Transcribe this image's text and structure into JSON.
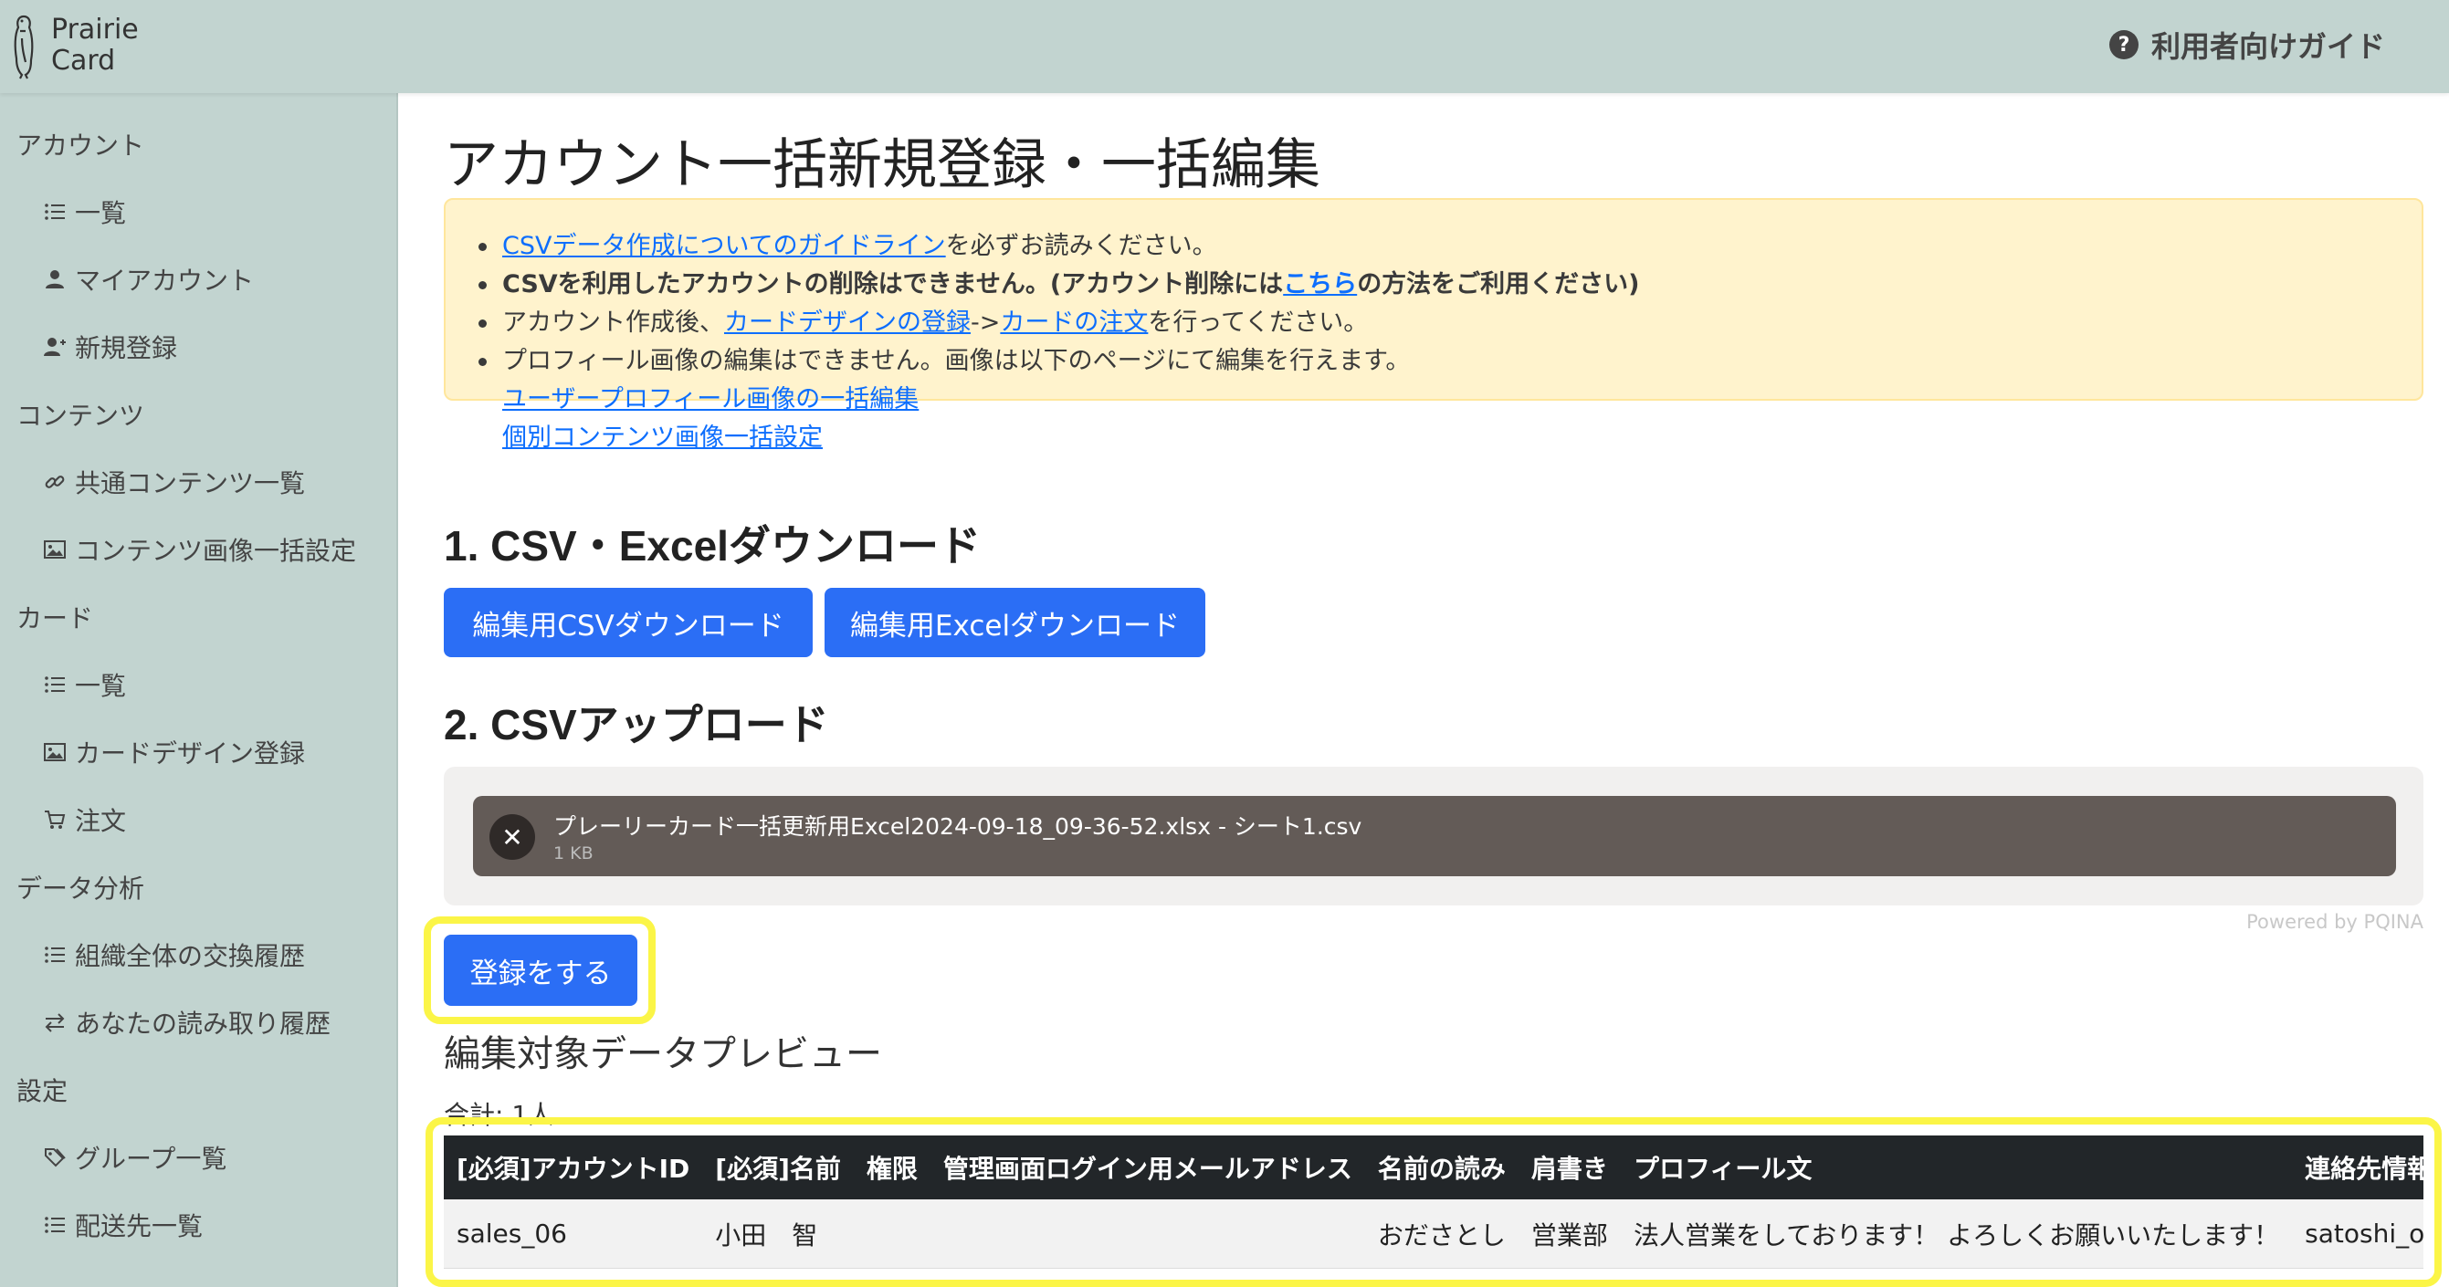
{
  "header": {
    "logo_line1": "Prairie",
    "logo_line2": "Card",
    "guide_label": "利用者向けガイド"
  },
  "sidebar": {
    "sections": {
      "account": "アカウント",
      "contents": "コンテンツ",
      "card": "カード",
      "analytics": "データ分析",
      "settings": "設定"
    },
    "items": {
      "account_list": "一覧",
      "my_account": "マイアカウント",
      "new_registration": "新規登録",
      "shared_contents": "共通コンテンツ一覧",
      "content_images": "コンテンツ画像一括設定",
      "card_list": "一覧",
      "card_design": "カードデザイン登録",
      "order": "注文",
      "org_exchange_history": "組織全体の交換履歴",
      "your_read_history": "あなたの読み取り履歴",
      "group_list": "グループ一覧",
      "delivery_list": "配送先一覧"
    }
  },
  "main": {
    "title": "アカウント一括新規登録・一括編集",
    "notice": {
      "line1_link": "CSVデータ作成についてのガイドライン",
      "line1_text": "を必ずお読みください。",
      "line2_pre": "CSVを利用したアカウントの削除はできません。(アカウント削除には",
      "line2_link": "こちら",
      "line2_post": "の方法をご利用ください)",
      "line3_pre": "アカウント作成後、",
      "line3_link1": "カードデザインの登録",
      "line3_mid": "->",
      "line3_link2": "カードの注文",
      "line3_post": "を行ってください。",
      "line4": "プロフィール画像の編集はできません。画像は以下のページにて編集を行えます。",
      "line5_link": "ユーザープロフィール画像の一括編集",
      "line6_link": "個別コンテンツ画像一括設定"
    },
    "section1": "1. CSV・Excelダウンロード",
    "btn_csv_download": "編集用CSVダウンロード",
    "btn_excel_download": "編集用Excelダウンロード",
    "section2": "2. CSVアップロード",
    "upload": {
      "file_name": "プレーリーカード一括更新用Excel2024-09-18_09-36-52.xlsx - シート1.csv",
      "file_size": "1 KB",
      "powered_by": "Powered by PQINA"
    },
    "btn_register": "登録をする",
    "preview_title": "編集対象データプレビュー",
    "total": "合計: 1人",
    "table": {
      "headers": [
        "[必須]アカウントID",
        "[必須]名前",
        "権限",
        "管理画面ログイン用メールアドレス",
        "名前の読み",
        "肩書き",
        "プロフィール文",
        "連絡先情報"
      ],
      "rows": [
        [
          "sales_06",
          "小田　智",
          "",
          "",
          "おださとし",
          "営業部",
          "法人営業をしております！ よろしくお願いいたします！",
          "satoshi_oda"
        ]
      ]
    }
  },
  "colors": {
    "header_bg": "#c2d4d0",
    "primary_button": "#2b6ef5",
    "notice_bg": "#fff3cd",
    "highlight": "#fbf547",
    "table_header_bg": "#222629"
  }
}
